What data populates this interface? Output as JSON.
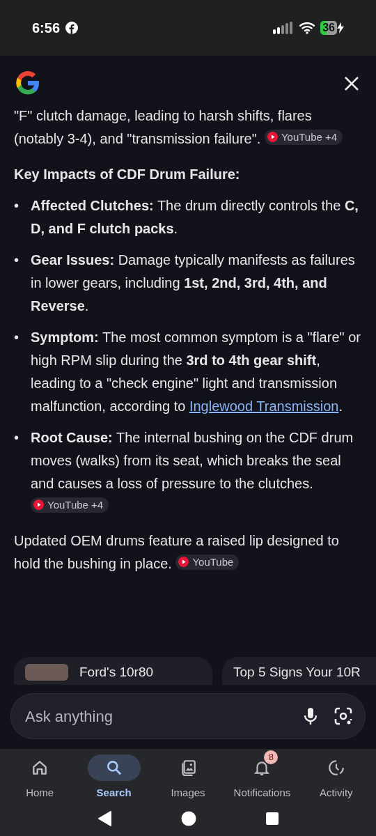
{
  "status_bar": {
    "time": "6:56",
    "battery": "36"
  },
  "intro": {
    "text": "\"F\" clutch damage, leading to harsh shifts, flares (notably 3-4), and \"transmission failure\".",
    "source": "YouTube +4"
  },
  "heading": "Key Impacts of CDF Drum Failure:",
  "bullets": [
    {
      "marker": "•",
      "text": "**Affected Clutches:** The drum directly controls the **C, D, and F clutch packs**."
    },
    {
      "marker": "•",
      "text": "**Gear Issues:** Damage typically manifests as failures in lower gears, including **1st, 2nd, 3rd, 4th, and Reverse**."
    },
    {
      "marker": "•",
      "text": "**Symptom:** The most common symptom is a \"flare\" or high RPM slip during the **3rd to 4th gear shift**, leading to a \"check engine\" light and transmission malfunction, according to",
      "link": "Inglewood Transmission",
      "text_after": "."
    },
    {
      "marker": "•",
      "text": "**Root Cause:** The internal bushing on the CDF drum moves (walks) from its seat, which breaks the seal and causes a loss of pressure to the clutches.",
      "source": "YouTube +4"
    }
  ],
  "closing": {
    "text": "Updated OEM drums feature a raised lip designed to hold the bushing in place.",
    "source": "YouTube"
  },
  "cards": [
    {
      "title": "Ford's 10r80"
    },
    {
      "title": "Top 5 Signs Your 10R"
    }
  ],
  "search": {
    "placeholder": "Ask anything"
  },
  "nav": [
    {
      "label": "Home",
      "selected": false
    },
    {
      "label": "Search",
      "selected": true
    },
    {
      "label": "Images",
      "selected": false
    },
    {
      "label": "Notifications",
      "selected": false,
      "badge": "8"
    },
    {
      "label": "Activity",
      "selected": false
    }
  ]
}
